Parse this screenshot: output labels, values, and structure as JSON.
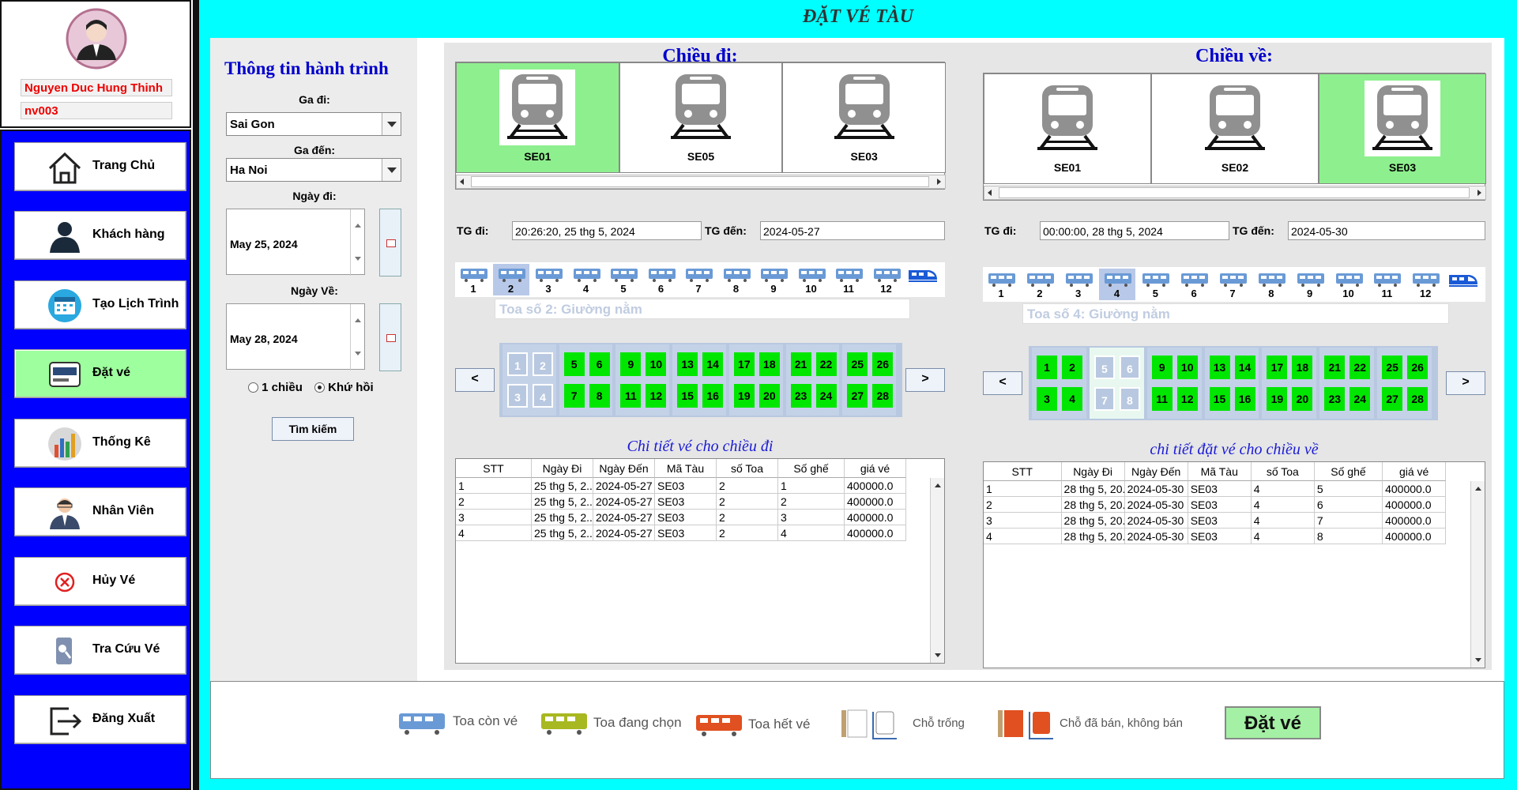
{
  "app_title": "ĐẶT VÉ TÀU",
  "user": {
    "name": "Nguyen Duc Hung Thinh",
    "id": "nv003"
  },
  "menu": [
    {
      "label": "Trang Chủ",
      "icon": "home-icon"
    },
    {
      "label": "Khách hàng",
      "icon": "customer-icon"
    },
    {
      "label": "Tạo Lịch Trình",
      "icon": "calendar-icon"
    },
    {
      "label": "Đặt vé",
      "icon": "ticket-icon",
      "active": true
    },
    {
      "label": "Thống Kê",
      "icon": "chart-icon"
    },
    {
      "label": "Nhân Viên",
      "icon": "employee-icon"
    },
    {
      "label": "Hủy Vé",
      "icon": "cancel-icon"
    },
    {
      "label": "Tra Cứu Vé",
      "icon": "search-ticket-icon"
    },
    {
      "label": "Đăng Xuất",
      "icon": "logout-icon"
    }
  ],
  "trip_info": {
    "title": "Thông tin hành trình",
    "from_label": "Ga đi:",
    "from_value": "Sai Gon",
    "to_label": "Ga đến:",
    "to_value": "Ha Noi",
    "depart_label": "Ngày đi:",
    "depart_value": "May 25, 2024",
    "return_label": "Ngày Về:",
    "return_value": "May 28, 2024",
    "oneway_label": "1 chiều",
    "roundtrip_label": "Khứ hồi",
    "selected_mode": "Khứ hồi",
    "search_label": "Tìm kiếm"
  },
  "outbound": {
    "title": "Chiều đi:",
    "trains": [
      {
        "code": "SE01",
        "selected": true
      },
      {
        "code": "SE05",
        "selected": false
      },
      {
        "code": "SE03",
        "selected": false
      }
    ],
    "tg_di_label": "TG đi:",
    "tg_di": "20:26:20, 25 thg 5, 2024",
    "tg_den_label": "TG đến:",
    "tg_den": "2024-05-27",
    "coaches": [
      "1",
      "2",
      "3",
      "4",
      "5",
      "6",
      "7",
      "8",
      "9",
      "10",
      "11",
      "12"
    ],
    "selected_coach": "2",
    "coach_label": "Toa số 2: Giường nằm",
    "prev": "<",
    "next": ">",
    "seats_top": [
      "1",
      "2",
      "5",
      "6",
      "9",
      "10",
      "13",
      "14",
      "17",
      "18",
      "21",
      "22",
      "25",
      "26"
    ],
    "seats_bottom": [
      "3",
      "4",
      "7",
      "8",
      "11",
      "12",
      "15",
      "16",
      "19",
      "20",
      "23",
      "24",
      "27",
      "28"
    ],
    "table_title": "Chi tiết vé cho chiều đi"
  },
  "return": {
    "title": "Chiều về:",
    "trains": [
      {
        "code": "SE01",
        "selected": false
      },
      {
        "code": "SE02",
        "selected": false
      },
      {
        "code": "SE03",
        "selected": true
      }
    ],
    "tg_di_label": "TG đi:",
    "tg_di": "00:00:00, 28 thg 5, 2024",
    "tg_den_label": "TG đến:",
    "tg_den": "2024-05-30",
    "coaches": [
      "1",
      "2",
      "3",
      "4",
      "5",
      "6",
      "7",
      "8",
      "9",
      "10",
      "11",
      "12"
    ],
    "selected_coach": "4",
    "coach_label": "Toa số 4: Giường nằm",
    "prev": "<",
    "next": ">",
    "seats_top": [
      "1",
      "2",
      "5",
      "6",
      "9",
      "10",
      "13",
      "14",
      "17",
      "18",
      "21",
      "22",
      "25",
      "26"
    ],
    "seats_bottom": [
      "3",
      "4",
      "7",
      "8",
      "11",
      "12",
      "15",
      "16",
      "19",
      "20",
      "23",
      "24",
      "27",
      "28"
    ],
    "table_title": "chi tiết đặt vé cho chiều về"
  },
  "table_headers": [
    "STT",
    "Ngày Đi",
    "Ngày Đến",
    "Mã Tàu",
    "số Toa",
    "Số ghế",
    "giá vé"
  ],
  "outbound_rows": [
    [
      "1",
      "25 thg 5, 2...",
      "2024-05-27",
      "SE03",
      "2",
      "1",
      "400000.0"
    ],
    [
      "2",
      "25 thg 5, 2...",
      "2024-05-27",
      "SE03",
      "2",
      "2",
      "400000.0"
    ],
    [
      "3",
      "25 thg 5, 2...",
      "2024-05-27",
      "SE03",
      "2",
      "3",
      "400000.0"
    ],
    [
      "4",
      "25 thg 5, 2...",
      "2024-05-27",
      "SE03",
      "2",
      "4",
      "400000.0"
    ]
  ],
  "return_rows": [
    [
      "1",
      "28 thg 5, 20...",
      "2024-05-30",
      "SE03",
      "4",
      "5",
      "400000.0"
    ],
    [
      "2",
      "28 thg 5, 20...",
      "2024-05-30",
      "SE03",
      "4",
      "6",
      "400000.0"
    ],
    [
      "3",
      "28 thg 5, 20...",
      "2024-05-30",
      "SE03",
      "4",
      "7",
      "400000.0"
    ],
    [
      "4",
      "28 thg 5, 20...",
      "2024-05-30",
      "SE03",
      "4",
      "8",
      "400000.0"
    ]
  ],
  "legend": {
    "available": "Toa còn vé",
    "selecting": "Toa đang chọn",
    "full": "Toa hết vé",
    "empty_seat": "Chỗ trống",
    "sold_seat": "Chỗ đã bán, không bán"
  },
  "book_button": "Đặt vé",
  "colors": {
    "accent_cyan": "#00ffff",
    "menu_blue": "#0000ff",
    "seat_green": "#00e600",
    "selected_green": "#8eef8e",
    "title_blue": "#0000cc"
  }
}
